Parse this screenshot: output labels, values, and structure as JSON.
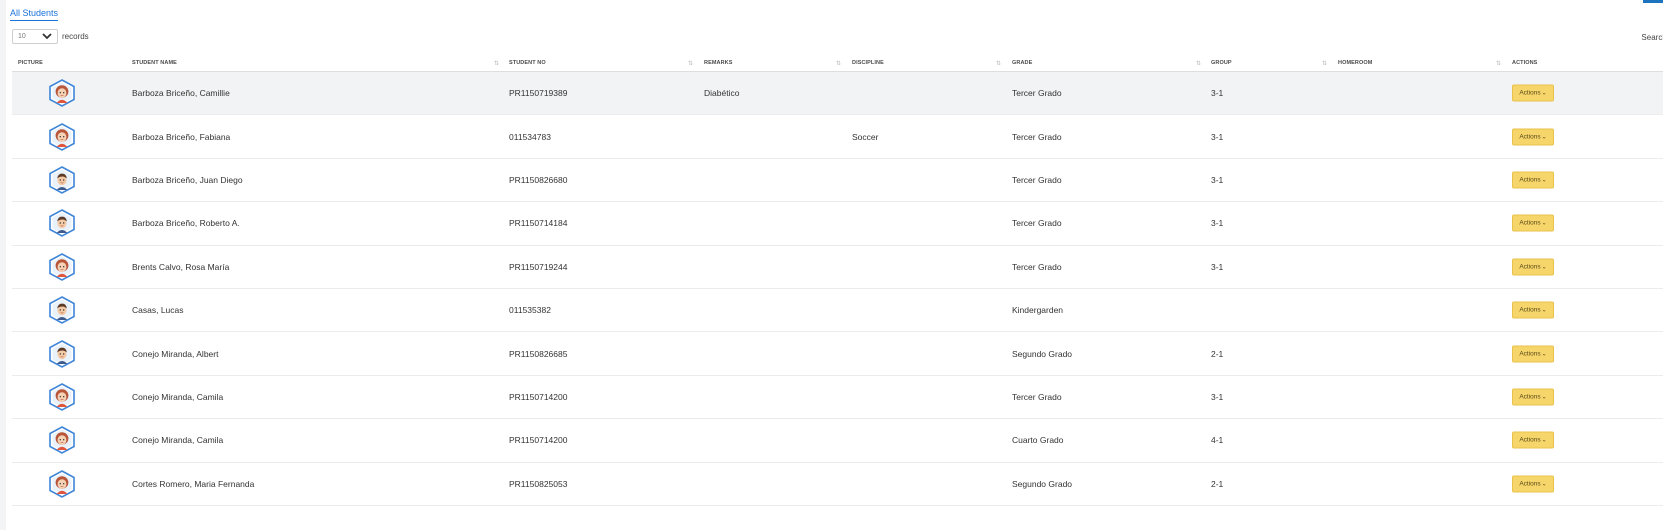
{
  "tabs": {
    "active": "All Students"
  },
  "length_control": {
    "value": "10",
    "label": "records"
  },
  "search": {
    "label": "Search:"
  },
  "table": {
    "headers": {
      "picture": "PICTURE",
      "student_name": "STUDENT NAME",
      "student_no": "STUDENT NO",
      "remarks": "REMARKS",
      "discipline": "DISCIPLINE",
      "grade": "GRADE",
      "group": "GROUP",
      "homeroom": "HOMEROOM",
      "actions": "ACTIONS"
    },
    "action_label": "Actions",
    "rows": [
      {
        "name": "Barboza Briceño, Camillie",
        "student_no": "PR1150719389",
        "remarks": "Diabético",
        "discipline": "",
        "grade": "Tercer Grado",
        "group": "3-1",
        "homeroom": "",
        "avatar": "girl-avatar-icon"
      },
      {
        "name": "Barboza Briceño, Fabiana",
        "student_no": "011534783",
        "remarks": "",
        "discipline": "Soccer",
        "grade": "Tercer Grado",
        "group": "3-1",
        "homeroom": "",
        "avatar": "girl-avatar-icon"
      },
      {
        "name": "Barboza Briceño, Juan Diego",
        "student_no": "PR1150826680",
        "remarks": "",
        "discipline": "",
        "grade": "Tercer Grado",
        "group": "3-1",
        "homeroom": "",
        "avatar": "boy-avatar-icon"
      },
      {
        "name": "Barboza Briceño, Roberto A.",
        "student_no": "PR1150714184",
        "remarks": "",
        "discipline": "",
        "grade": "Tercer Grado",
        "group": "3-1",
        "homeroom": "",
        "avatar": "boy-avatar-icon"
      },
      {
        "name": "Brents Calvo, Rosa María",
        "student_no": "PR1150719244",
        "remarks": "",
        "discipline": "",
        "grade": "Tercer Grado",
        "group": "3-1",
        "homeroom": "",
        "avatar": "girl-avatar-icon"
      },
      {
        "name": "Casas, Lucas",
        "student_no": "011535382",
        "remarks": "",
        "discipline": "",
        "grade": "Kindergarden",
        "group": "",
        "homeroom": "",
        "avatar": "boy-avatar-icon"
      },
      {
        "name": "Conejo Miranda, Albert",
        "student_no": "PR1150826685",
        "remarks": "",
        "discipline": "",
        "grade": "Segundo Grado",
        "group": "2-1",
        "homeroom": "",
        "avatar": "boy-avatar-icon"
      },
      {
        "name": "Conejo Miranda, Camila",
        "student_no": "PR1150714200",
        "remarks": "",
        "discipline": "",
        "grade": "Tercer Grado",
        "group": "3-1",
        "homeroom": "",
        "avatar": "girl-avatar-icon"
      },
      {
        "name": "Conejo Miranda, Camila",
        "student_no": "PR1150714200",
        "remarks": "",
        "discipline": "",
        "grade": "Cuarto Grado",
        "group": "4-1",
        "homeroom": "",
        "avatar": "girl-avatar-icon"
      },
      {
        "name": "Cortes Romero, Maria Fernanda",
        "student_no": "PR1150825053",
        "remarks": "",
        "discipline": "",
        "grade": "Segundo Grado",
        "group": "2-1",
        "homeroom": "",
        "avatar": "girl-avatar-icon"
      }
    ]
  },
  "colors": {
    "accent": "#1a73d9",
    "action_button": "#f6d66a",
    "highlight_row": "#f2f3f4"
  }
}
